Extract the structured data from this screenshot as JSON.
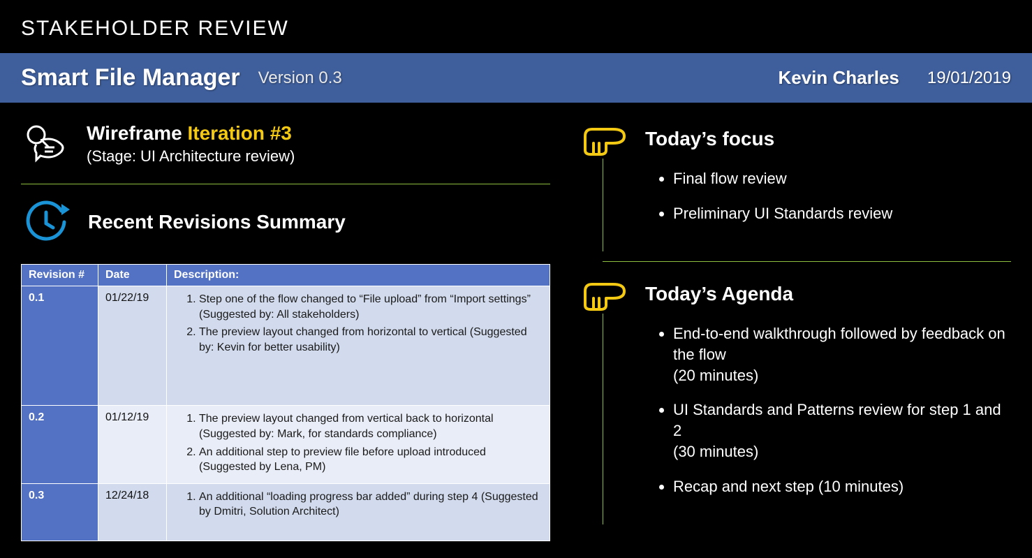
{
  "page_title": "STAKEHOLDER REVIEW",
  "banner": {
    "product": "Smart File Manager",
    "version_label": "Version 0.3",
    "author": "Kevin Charles",
    "date": "19/01/2019"
  },
  "wireframe": {
    "prefix": "Wireframe",
    "highlight": "Iteration #3",
    "stage": "(Stage: UI Architecture review)"
  },
  "revisions_title": "Recent Revisions Summary",
  "revisions_headers": {
    "rev": "Revision #",
    "date": "Date",
    "desc": "Description:"
  },
  "revisions": [
    {
      "rev": "0.1",
      "date": "01/22/19",
      "items": [
        "Step one of the flow changed to “File upload” from “Import settings” (Suggested by: All stakeholders)",
        "The preview layout changed from horizontal to vertical (Suggested by: Kevin for better usability)"
      ]
    },
    {
      "rev": "0.2",
      "date": "01/12/19",
      "items": [
        "The preview layout changed from vertical back to horizontal (Suggested by: Mark, for standards compliance)",
        "An additional step to preview file before upload introduced (Suggested by Lena, PM)"
      ]
    },
    {
      "rev": "0.3",
      "date": "12/24/18",
      "items": [
        "An additional “loading progress bar added” during step 4 (Suggested by Dmitri, Solution Architect)"
      ]
    }
  ],
  "focus": {
    "title": "Today’s focus",
    "items": [
      "Final flow review",
      "Preliminary UI Standards review"
    ]
  },
  "agenda": {
    "title": "Today’s Agenda",
    "items": [
      "End-to-end walkthrough followed by feedback on the flow\n(20 minutes)",
      "UI Standards and Patterns review for step 1 and 2\n(30 minutes)",
      "Recap and next step (10 minutes)"
    ]
  }
}
